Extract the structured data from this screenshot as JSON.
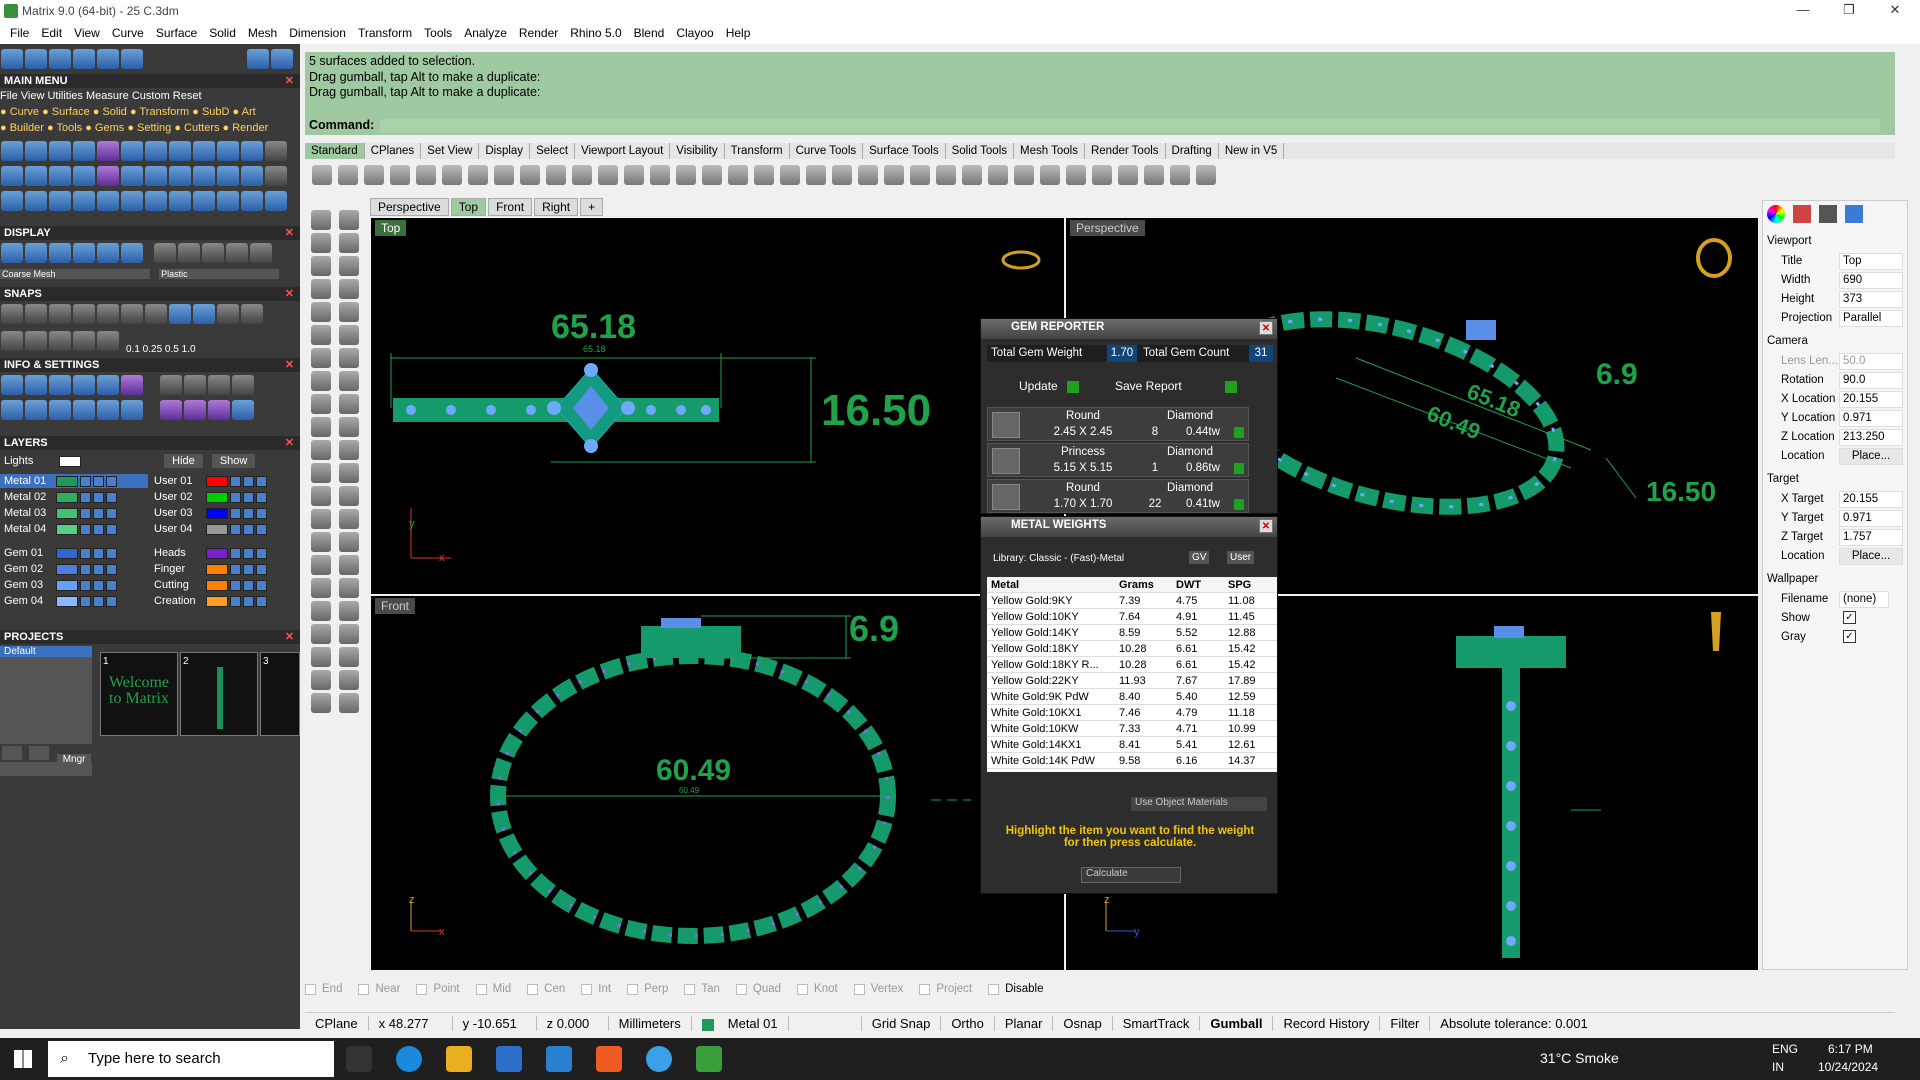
{
  "window": {
    "title": "Matrix 9.0 (64-bit) - 25 C.3dm",
    "minimize": "—",
    "restore": "❐",
    "close": "✕"
  },
  "menu": [
    "File",
    "Edit",
    "View",
    "Curve",
    "Surface",
    "Solid",
    "Mesh",
    "Dimension",
    "Transform",
    "Tools",
    "Analyze",
    "Render",
    "Rhino 5.0",
    "Blend",
    "Clayoo",
    "Help"
  ],
  "left": {
    "main_menu": "MAIN MENU",
    "menu_row1": "File   View   Utilities   Measure   Custom      Reset",
    "menu_row2": "● Curve ● Surface ● Solid ● Transform ● SubD    ● Art",
    "menu_row3": "● Builder ● Tools ● Gems ● Setting ● Cutters ● Render",
    "display": "DISPLAY",
    "display_mesh": "Coarse Mesh",
    "display_mat": "Plastic",
    "snaps": "SNAPS",
    "snap_vals": "0.1   0.25   0.5   1.0",
    "info": "INFO & SETTINGS",
    "layers": "LAYERS",
    "lights": "Lights",
    "hide": "Hide",
    "show": "Show",
    "layers_left": [
      {
        "name": "Metal 01",
        "color": "#1f9a5a"
      },
      {
        "name": "Metal 02",
        "color": "#2fae5f"
      },
      {
        "name": "Metal 03",
        "color": "#43c071"
      },
      {
        "name": "Metal 04",
        "color": "#58d083"
      },
      {
        "name": "Gem 01",
        "color": "#3366cc"
      },
      {
        "name": "Gem 02",
        "color": "#4d7fe0"
      },
      {
        "name": "Gem 03",
        "color": "#66a0ff"
      },
      {
        "name": "Gem 04",
        "color": "#88b8ff"
      }
    ],
    "layers_right": [
      {
        "name": "User 01",
        "color": "#ff0000"
      },
      {
        "name": "User 02",
        "color": "#00cc00"
      },
      {
        "name": "User 03",
        "color": "#0000ff"
      },
      {
        "name": "User 04",
        "color": "#999999"
      },
      {
        "name": "Heads",
        "color": "#7a1fd0"
      },
      {
        "name": "Finger",
        "color": "#ff7f00"
      },
      {
        "name": "Cutting",
        "color": "#ff7f00"
      },
      {
        "name": "Creation",
        "color": "#ff9f20"
      }
    ],
    "projects": "PROJECTS",
    "project_default": "Default",
    "project_thumbs": [
      "1",
      "2",
      "3"
    ],
    "welcome": "Welcome to Matrix",
    "mngr": "Mngr"
  },
  "command": {
    "history": [
      "5 surfaces added to selection.",
      "Drag gumball, tap Alt to make a duplicate:",
      "Drag gumball, tap Alt to make a duplicate:"
    ],
    "prompt": "Command:"
  },
  "tabs": [
    "Standard",
    "CPlanes",
    "Set View",
    "Display",
    "Select",
    "Viewport Layout",
    "Visibility",
    "Transform",
    "Curve Tools",
    "Surface Tools",
    "Solid Tools",
    "Mesh Tools",
    "Render Tools",
    "Drafting",
    "New in V5"
  ],
  "viewport_tabs": [
    "Perspective",
    "Top",
    "Front",
    "Right",
    "+"
  ],
  "viewports": {
    "top": {
      "label": "Top",
      "dim1": "65.18",
      "dim2": "16.50",
      "small": "65.18"
    },
    "perspective": {
      "label": "Perspective",
      "dim1": "6.9",
      "dim2": "65.18",
      "dim3": "60.49",
      "dim4": "16.50"
    },
    "front": {
      "label": "Front",
      "dim1": "6.9",
      "dim2": "60.49",
      "small": "60.49"
    },
    "axes_x": "x",
    "axes_y": "y",
    "axes_z": "z"
  },
  "gem_reporter": {
    "title": "GEM REPORTER",
    "total_weight_label": "Total Gem Weight",
    "total_weight": "1.70",
    "total_count_label": "Total Gem Count",
    "total_count": "31",
    "update": "Update",
    "save": "Save Report",
    "rows": [
      {
        "shape": "Round",
        "size": "2.45 X 2.45",
        "type": "Diamond",
        "count": "8",
        "ctw": "0.44tw"
      },
      {
        "shape": "Princess",
        "size": "5.15 X 5.15",
        "type": "Diamond",
        "count": "1",
        "ctw": "0.86tw"
      },
      {
        "shape": "Round",
        "size": "1.70 X 1.70",
        "type": "Diamond",
        "count": "22",
        "ctw": "0.41tw"
      }
    ]
  },
  "metal_weights": {
    "title": "METAL WEIGHTS",
    "library": "Library: Classic - (Fast)-Metal",
    "gv": "GV",
    "user": "User",
    "columns": [
      "Metal",
      "Grams",
      "DWT",
      "SPG"
    ],
    "rows": [
      [
        "Yellow Gold:9KY",
        "7.39",
        "4.75",
        "11.08"
      ],
      [
        "Yellow Gold:10KY",
        "7.64",
        "4.91",
        "11.45"
      ],
      [
        "Yellow Gold:14KY",
        "8.59",
        "5.52",
        "12.88"
      ],
      [
        "Yellow Gold:18KY",
        "10.28",
        "6.61",
        "15.42"
      ],
      [
        "Yellow Gold:18KY R...",
        "10.28",
        "6.61",
        "15.42"
      ],
      [
        "Yellow Gold:22KY",
        "11.93",
        "7.67",
        "17.89"
      ],
      [
        "White Gold:9K PdW",
        "8.40",
        "5.40",
        "12.59"
      ],
      [
        "White Gold:10KX1",
        "7.46",
        "4.79",
        "11.18"
      ],
      [
        "White Gold:10KW",
        "7.33",
        "4.71",
        "10.99"
      ],
      [
        "White Gold:14KX1",
        "8.41",
        "5.41",
        "12.61"
      ],
      [
        "White Gold:14K PdW",
        "9.58",
        "6.16",
        "14.37"
      ]
    ],
    "use_obj": "Use Object Materials",
    "hint": "Highlight the item you want to find the weight for then press calculate.",
    "calculate": "Calculate"
  },
  "properties": {
    "viewport": "Viewport",
    "title_l": "Title",
    "title_v": "Top",
    "width_l": "Width",
    "width_v": "690",
    "height_l": "Height",
    "height_v": "373",
    "proj_l": "Projection",
    "proj_v": "Parallel",
    "camera": "Camera",
    "lens_l": "Lens Len...",
    "lens_v": "50.0",
    "rot_l": "Rotation",
    "rot_v": "90.0",
    "xl_l": "X Location",
    "xl_v": "20.155",
    "yl_l": "Y Location",
    "yl_v": "0.971",
    "zl_l": "Z Location",
    "zl_v": "213.250",
    "loc_l": "Location",
    "place": "Place...",
    "target": "Target",
    "xt_l": "X Target",
    "xt_v": "20.155",
    "yt_l": "Y Target",
    "yt_v": "0.971",
    "zt_l": "Z Target",
    "zt_v": "1.757",
    "wallpaper": "Wallpaper",
    "fn_l": "Filename",
    "fn_v": "(none)",
    "show_l": "Show",
    "gray_l": "Gray"
  },
  "osnaps": [
    "End",
    "Near",
    "Point",
    "Mid",
    "Cen",
    "Int",
    "Perp",
    "Tan",
    "Quad",
    "Knot",
    "Vertex",
    "Project",
    "Disable"
  ],
  "status": {
    "cplane": "CPlane",
    "x": "x 48.277",
    "y": "y -10.651",
    "z": "z 0.000",
    "units": "Millimeters",
    "layer": "Metal 01",
    "grid": "Grid Snap",
    "ortho": "Ortho",
    "planar": "Planar",
    "osnap": "Osnap",
    "smart": "SmartTrack",
    "gumball": "Gumball",
    "record": "Record History",
    "filter": "Filter",
    "tol": "Absolute tolerance: 0.001"
  },
  "taskbar": {
    "search": "Type here to search",
    "weather": "31°C  Smoke",
    "lang1": "ENG",
    "lang2": "IN",
    "time": "6:17 PM",
    "date": "10/24/2024"
  }
}
